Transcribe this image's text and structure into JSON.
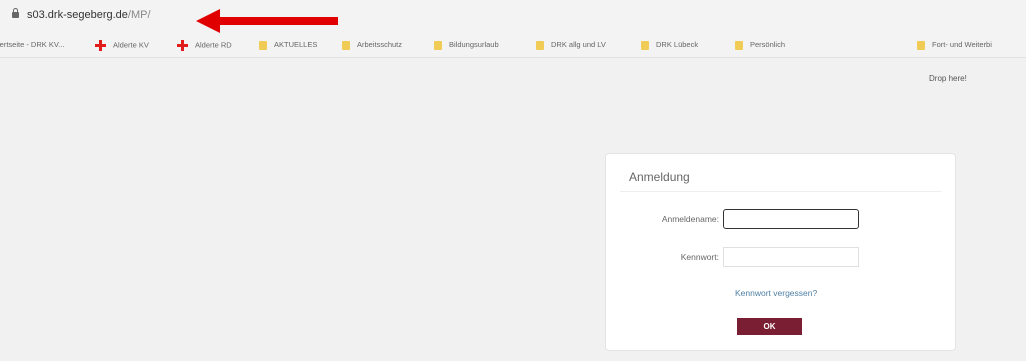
{
  "browser": {
    "url_host": "s03.drk-segeberg.de",
    "url_path": "/MP/",
    "accent_color": "#e00000"
  },
  "bookmarks": [
    {
      "label": "lertseite - DRK KV...",
      "icon": "none"
    },
    {
      "label": "Alderte KV",
      "icon": "red-cross-icon"
    },
    {
      "label": "Alderte RD",
      "icon": "red-cross-icon"
    },
    {
      "label": "AKTUELLES",
      "icon": "folder-icon"
    },
    {
      "label": "Arbeitsschutz",
      "icon": "folder-icon"
    },
    {
      "label": "Bildungsurlaub",
      "icon": "folder-icon"
    },
    {
      "label": "DRK allg und LV",
      "icon": "folder-icon"
    },
    {
      "label": "DRK Lübeck",
      "icon": "folder-icon"
    },
    {
      "label": "Persönlich",
      "icon": "folder-icon"
    },
    {
      "label": "Fort- und Weiterbi",
      "icon": "folder-icon"
    }
  ],
  "page": {
    "drop_here": "Drop here!"
  },
  "login": {
    "title": "Anmeldung",
    "username_label": "Anmeldename:",
    "username_value": "",
    "password_label": "Kennwort:",
    "password_value": "",
    "forgot_link": "Kennwort vergessen?",
    "ok_button": "OK",
    "button_color": "#7a1f33"
  }
}
